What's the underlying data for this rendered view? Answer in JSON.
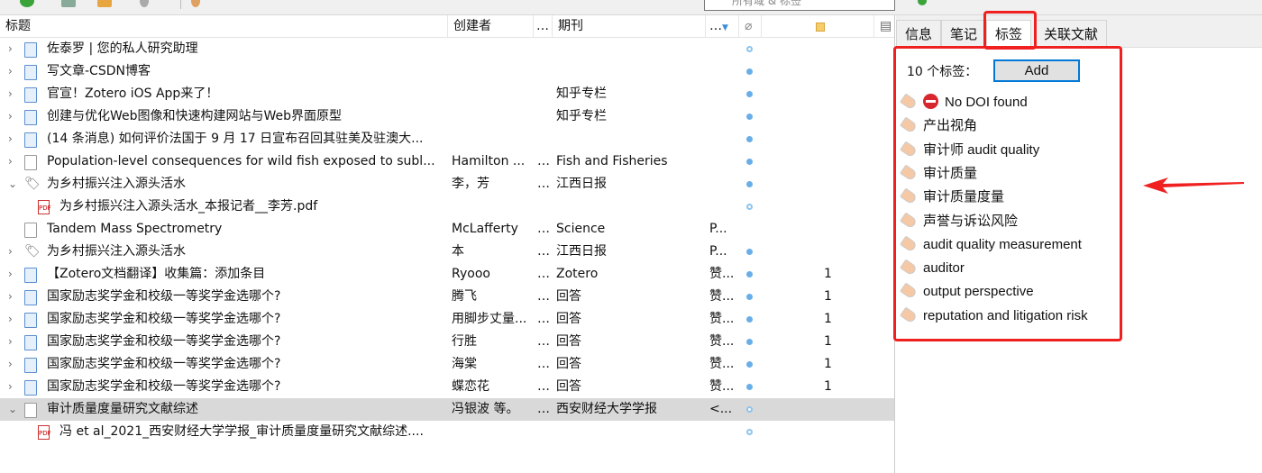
{
  "toolbar": {
    "search_placeholder": "所有域 & 标签"
  },
  "columns": {
    "title": "标题",
    "creator": "创建者",
    "more1": "…",
    "journal": "期刊",
    "more2": "…"
  },
  "rows": [
    {
      "icon": "webpage",
      "expand": "›",
      "title": "佐泰罗 | 您的私人研究助理",
      "creator": "",
      "dots": "",
      "journal": "",
      "extra": "",
      "attach": "hollow",
      "notes": ""
    },
    {
      "icon": "webpage",
      "expand": "›",
      "title": "写文章-CSDN博客",
      "creator": "",
      "dots": "",
      "journal": "",
      "extra": "",
      "attach": "full",
      "notes": ""
    },
    {
      "icon": "webpage",
      "expand": "›",
      "title": "官宣！Zotero iOS App来了！",
      "creator": "",
      "dots": "",
      "journal": "知乎专栏",
      "extra": "",
      "attach": "full",
      "notes": ""
    },
    {
      "icon": "webpage",
      "expand": "›",
      "title": "创建与优化Web图像和快速构建网站与Web界面原型",
      "creator": "",
      "dots": "",
      "journal": "知乎专栏",
      "extra": "",
      "attach": "full",
      "notes": ""
    },
    {
      "icon": "webpage",
      "expand": "›",
      "title": "(14 条消息) 如何评价法国于 9 月 17 日宣布召回其驻美及驻澳大...",
      "creator": "",
      "dots": "",
      "journal": "",
      "extra": "",
      "attach": "full",
      "notes": ""
    },
    {
      "icon": "article",
      "expand": "›",
      "title": "Population-level consequences for wild fish exposed to subl...",
      "creator": "Hamilton ...",
      "dots": "…",
      "journal": "Fish and Fisheries",
      "extra": "",
      "attach": "full",
      "notes": ""
    },
    {
      "icon": "newspaper",
      "expand": "⌄",
      "title": "为乡村振兴注入源头活水",
      "creator": "李，芳",
      "dots": "…",
      "journal": "江西日报",
      "extra": "",
      "attach": "full",
      "notes": ""
    },
    {
      "icon": "pdf",
      "child": true,
      "title": "为乡村振兴注入源头活水_本报记者__李芳.pdf",
      "creator": "",
      "dots": "",
      "journal": "",
      "extra": "",
      "attach": "hollow",
      "notes": ""
    },
    {
      "icon": "article",
      "expand": "",
      "title": "Tandem Mass Spectrometry",
      "creator": "McLafferty",
      "dots": "…",
      "journal": "Science",
      "extra": "P...",
      "attach": "",
      "notes": ""
    },
    {
      "icon": "newspaper",
      "expand": "›",
      "title": "为乡村振兴注入源头活水",
      "creator": "本",
      "dots": "…",
      "journal": "江西日报",
      "extra": "P...",
      "attach": "full",
      "notes": ""
    },
    {
      "icon": "webpage",
      "expand": "›",
      "title": "【Zotero文档翻译】收集篇：添加条目",
      "creator": "Ryooo",
      "dots": "…",
      "journal": "Zotero",
      "extra": "赞...",
      "attach": "full",
      "notes": "1"
    },
    {
      "icon": "webpage",
      "expand": "›",
      "title": "国家励志奖学金和校级一等奖学金选哪个?",
      "creator": "腾飞",
      "dots": "…",
      "journal": "回答",
      "extra": "赞...",
      "attach": "full",
      "notes": "1"
    },
    {
      "icon": "webpage",
      "expand": "›",
      "title": "国家励志奖学金和校级一等奖学金选哪个?",
      "creator": "用脚步丈量...",
      "dots": "…",
      "journal": "回答",
      "extra": "赞...",
      "attach": "full",
      "notes": "1"
    },
    {
      "icon": "webpage",
      "expand": "›",
      "title": "国家励志奖学金和校级一等奖学金选哪个?",
      "creator": "行胜",
      "dots": "…",
      "journal": "回答",
      "extra": "赞...",
      "attach": "full",
      "notes": "1"
    },
    {
      "icon": "webpage",
      "expand": "›",
      "title": "国家励志奖学金和校级一等奖学金选哪个?",
      "creator": "海棠",
      "dots": "…",
      "journal": "回答",
      "extra": "赞...",
      "attach": "full",
      "notes": "1"
    },
    {
      "icon": "webpage",
      "expand": "›",
      "title": "国家励志奖学金和校级一等奖学金选哪个?",
      "creator": "蝶恋花",
      "dots": "…",
      "journal": "回答",
      "extra": "赞...",
      "attach": "full",
      "notes": "1"
    },
    {
      "icon": "article",
      "expand": "⌄",
      "selected": true,
      "title": "审计质量度量研究文献综述",
      "creator": "冯银波 等。",
      "dots": "…",
      "journal": "西安财经大学学报",
      "extra": "<...",
      "attach": "hollow",
      "notes": ""
    },
    {
      "icon": "pdf",
      "child": true,
      "title": "冯 et al_2021_西安财经大学学报_审计质量度量研究文献综述....",
      "creator": "",
      "dots": "",
      "journal": "",
      "extra": "",
      "attach": "hollow",
      "notes": ""
    }
  ],
  "pane": {
    "tabs": [
      "信息",
      "笔记",
      "标签",
      "关联文献"
    ],
    "active_tab": "标签",
    "tag_count": "10 个标签：",
    "add_label": "Add",
    "tags": [
      "No DOI found",
      "产出视角",
      "审计师 audit quality",
      "审计质量",
      "审计质量度量",
      "声誉与诉讼风险",
      "audit quality measurement",
      "auditor",
      "output perspective",
      "reputation and litigation risk"
    ]
  },
  "colors": {
    "highlight": "#f02020",
    "selected_row": "#d9d9d9",
    "attachment_dot": "#6aaee8"
  }
}
